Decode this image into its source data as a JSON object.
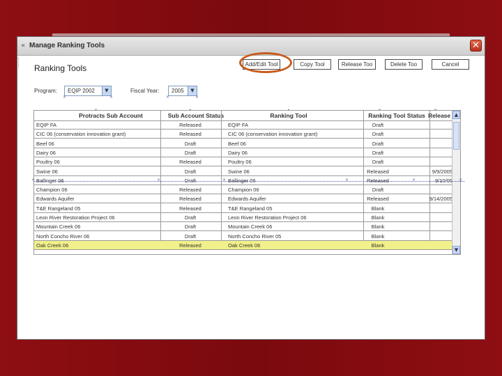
{
  "window": {
    "title": "Manage Ranking Tools",
    "close_glyph": "✕"
  },
  "page": {
    "heading": "Ranking Tools"
  },
  "toolbar": {
    "add_edit_label": "Add/Edit Tool",
    "copy_label": "Copy Tool",
    "release_label": "Release Too",
    "delete_label": "Delete Too",
    "cancel_label": "Cancel"
  },
  "filters": {
    "program_label": "Program:",
    "program_value": "EQIP 2002",
    "fiscal_year_label": "Fiscal Year:",
    "fiscal_year_value": "2005"
  },
  "grid": {
    "columns": [
      "Protracts Sub Account",
      "Sub Account Status",
      "Ranking Tool",
      "Ranking Tool Status",
      "Release Date"
    ],
    "rows": [
      {
        "sub_account": "EQIP FA",
        "sub_status": "Released",
        "tool": "EQIP FA",
        "tool_status": "Draft",
        "release_date": ""
      },
      {
        "sub_account": "CIC 06      (conservation innovation grant)",
        "sub_status": "Released",
        "tool": "CIC 06      (conservation innovation grant)",
        "tool_status": "Draft",
        "release_date": ""
      },
      {
        "sub_account": "Beef 06",
        "sub_status": "Draft",
        "tool": "Beef 06",
        "tool_status": "Draft",
        "release_date": ""
      },
      {
        "sub_account": "Dairy 06",
        "sub_status": "Draft",
        "tool": "Dairy 06",
        "tool_status": "Draft",
        "release_date": ""
      },
      {
        "sub_account": "Poultry 06",
        "sub_status": "Released",
        "tool": "Poultry 06",
        "tool_status": "Draft",
        "release_date": ""
      },
      {
        "sub_account": "Swine 06",
        "sub_status": "Draft",
        "tool": "Swine 06",
        "tool_status": "Released",
        "release_date": "9/9/2005"
      },
      {
        "sub_account": "Ballinger 06",
        "sub_status": "Draft",
        "tool": "Ballinger 06",
        "tool_status": "Released",
        "release_date": "9/10/05"
      },
      {
        "sub_account": "Champion 06",
        "sub_status": "Released",
        "tool": "Champion 06",
        "tool_status": "Draft",
        "release_date": ""
      },
      {
        "sub_account": "Edwards Aquifer",
        "sub_status": "Released",
        "tool": "Edwards Aquifer",
        "tool_status": "Released",
        "release_date": "9/14/2005"
      },
      {
        "sub_account": "T&E Rangeland 05",
        "sub_status": "Released",
        "tool": "T&E Rangeland 05",
        "tool_status": "Blank",
        "release_date": ""
      },
      {
        "sub_account": "Leon River Restoration Project 06",
        "sub_status": "Draft",
        "tool": "Leon River Restoration Project 06",
        "tool_status": "Blank",
        "release_date": ""
      },
      {
        "sub_account": "Mountain Creek 06",
        "sub_status": "Draft",
        "tool": "Mountain Creek 06",
        "tool_status": "Blank",
        "release_date": ""
      },
      {
        "sub_account": "North Concho River 06",
        "sub_status": "Draft",
        "tool": "North Concho River 05",
        "tool_status": "Blank",
        "release_date": ""
      },
      {
        "sub_account": "Oak Creek 06",
        "sub_status": "Released",
        "tool": "Oak Creek 06",
        "tool_status": "Blank",
        "release_date": "",
        "selected": true
      }
    ]
  },
  "colors": {
    "slide_background": "#8e0e12",
    "highlight_circle": "#c85a1a",
    "selected_row": "#f2f08a"
  }
}
